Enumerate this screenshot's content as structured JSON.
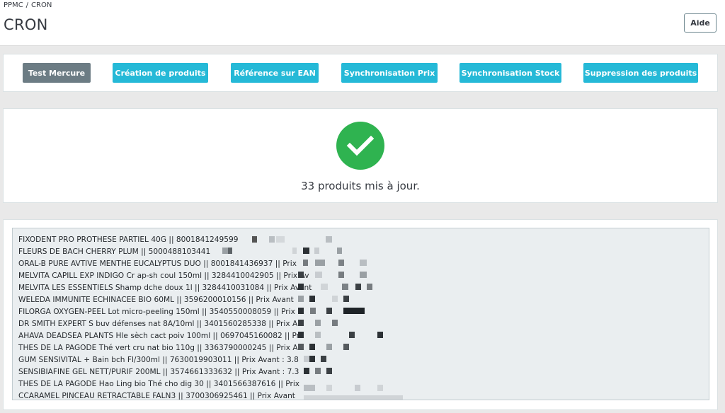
{
  "header": {
    "breadcrumb": [
      "PPMC",
      "/",
      "CRON"
    ],
    "title": "CRON",
    "help_label": "Aide"
  },
  "actions": [
    {
      "label": "Test Mercure",
      "active": true
    },
    {
      "label": "Création de produits",
      "active": false
    },
    {
      "label": "Référence sur EAN",
      "active": false
    },
    {
      "label": "Synchronisation Prix",
      "active": false
    },
    {
      "label": "Synchronisation Stock",
      "active": false
    },
    {
      "label": "Suppression des produits",
      "active": false
    }
  ],
  "status": {
    "icon": "check-icon",
    "color": "#2fb350",
    "message": "33 produits mis à jour."
  },
  "log": [
    "FIXODENT PRO PROTHESE PARTIEL 40G || 8001841249599",
    "FLEURS DE BACH CHERRY PLUM || 5000488103441",
    "ORAL-B PURE AVTIVE MENTHE EUCALYPTUS DUO || 8001841436937 || Prix",
    "MELVITA CAPILL EXP INDIGO Cr ap-sh coul 150ml || 3284410042905 || Prix Av",
    "MELVITA LES ESSENTIELS Shamp dche doux 1l || 3284410031084 || Prix Avant",
    "WELEDA IMMUNITE ECHINACEE BIO 60ML || 3596200010156 || Prix Avant",
    "FILORGA OXYGEN-PEEL Lot micro-peeling 150ml || 3540550008059 || Prix",
    "DR SMITH EXPERT S buv défenses nat 8A/10ml || 3401560285338 || Prix A",
    "AHAVA DEADSEA PLANTS Hle sèch cact poiv 100ml || 0697045160082 || Pr",
    "THES DE LA PAGODE Thé vert cru nat bio 110g || 3363790000245 || Prix A",
    "GUM SENSIVITAL + Bain bch Fl/300ml || 7630019903011 || Prix Avant : 3.8",
    "SENSIBIAFINE GEL NETT/PURIF 200ML || 3574661333632 || Prix Avant : 7.3",
    "THES DE LA PAGODE Hao Ling bio Thé cho dig 30 || 3401566387616 || Prix",
    "CCARAMEL PINCEAU RETRACTABLE FALN3 || 3700306925461 || Prix Avant"
  ]
}
